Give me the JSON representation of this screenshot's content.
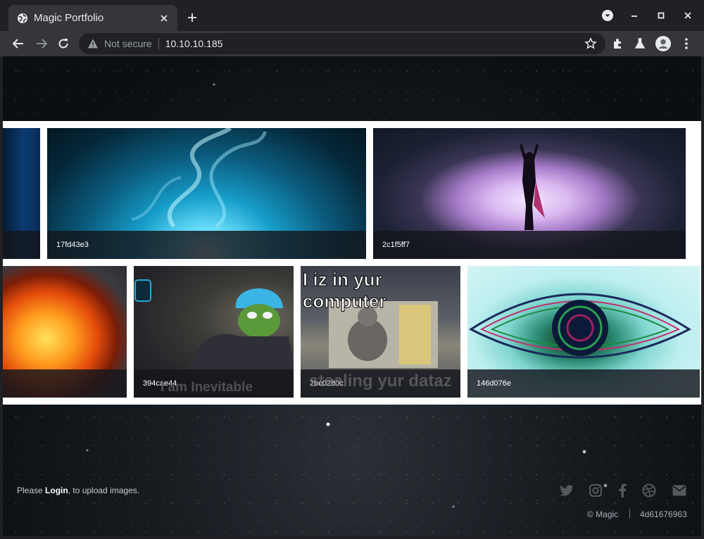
{
  "browser": {
    "tab_title": "Magic Portfolio",
    "security_label": "Not secure",
    "url": "10.10.10.185"
  },
  "gallery": {
    "row1": [
      {
        "caption": "",
        "image": "blue-abstract"
      },
      {
        "caption": "17fd43e3",
        "image": "blue-smoke"
      },
      {
        "caption": "2c1f5ff7",
        "image": "cave-silhouette"
      }
    ],
    "row2": [
      {
        "caption": "",
        "image": "fire"
      },
      {
        "caption": "394cae44",
        "image": "thanos-pepe",
        "overlay_text": "I am Inevitable"
      },
      {
        "caption": "2bc0280c",
        "image": "cat-computer",
        "top_text": "I iz in yur computer",
        "bottom_text": "stealing yur dataz"
      },
      {
        "caption": "146d076e",
        "image": "psychedelic-eye"
      }
    ]
  },
  "footer": {
    "login_prefix": "Please ",
    "login_link": "Login",
    "login_suffix": ", to upload images.",
    "copyright": "© Magic",
    "hash": "4d61676963",
    "social_icons": [
      "twitter-icon",
      "instagram-icon",
      "facebook-icon",
      "dribbble-icon",
      "email-icon"
    ]
  }
}
